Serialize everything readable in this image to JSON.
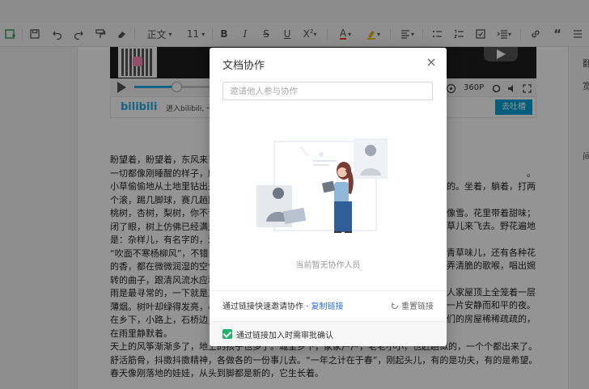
{
  "toolbar": {
    "font_family": "正文",
    "font_size": "11"
  },
  "video": {
    "resolution": "360P",
    "brand": "bilibili",
    "caption": "进入bilibili, 一起",
    "button": "去吐槽"
  },
  "document": {
    "lines": [
      "盼望着，盼望着，东风来了",
      "一切都像刚睡醒的样子，欣",
      "小草偷偷地从土地里钻出来",
      "个滚，踢几脚球，赛几趟跑",
      "桃树，杏树，梨树，你不让",
      "闭了眼，树上仿佛已经满是",
      "是：杂样儿，有名字的，没",
      "“吹面不寒杨柳风”，不错",
      "的香，都在微微润湿的空气",
      "转的曲子，跟清风流水应和",
      "雨是最寻常的，一下就是三",
      "薄烟。树叶却绿得发亮，小",
      "在乡下，小路上，石桥边，",
      "在雨里静默着。",
      "天上的风筝渐渐多了，地上的孩子也多了。城里乡下，家家户户，老老小小，也赶趟似的，一个个都出来了。舒活",
      "舒活筋骨，抖擞抖擞精神，各做各的一份事儿去。“一年之计在于春”，刚起头儿，有的是功夫，有的是希望。",
      "春天像刚落地的娃娃，从头到脚都是新的，它生长着。"
    ],
    "right_fragments": [
      "。",
      "的。坐着，躺着，打两",
      "像雪。花里带着甜味；",
      "草儿来飞去。野花遍地",
      "青草味儿，还有各种花",
      "卖弄清脆的歌喉，唱出婉",
      "人家屋顶上全笼着一层",
      "出一片安静而和平的夜。",
      "他们的房屋稀稀疏疏的，"
    ]
  },
  "right_panel": {
    "labels": [
      "翻",
      "宽",
      "间"
    ]
  },
  "dialog": {
    "title": "文档协作",
    "invite_placeholder": "邀请他人参与协作",
    "empty_text": "当前暂无协作人员",
    "link_text": "通过链接快速邀请协作 · ",
    "copy_link": "复制链接",
    "reset_link": "重置链接",
    "approval_text": "通过链接加入时需审批确认",
    "approval_checked": true
  },
  "colors": {
    "accent": "#2f6ee0",
    "check": "#22b06a",
    "bili": "#00a1d6"
  }
}
